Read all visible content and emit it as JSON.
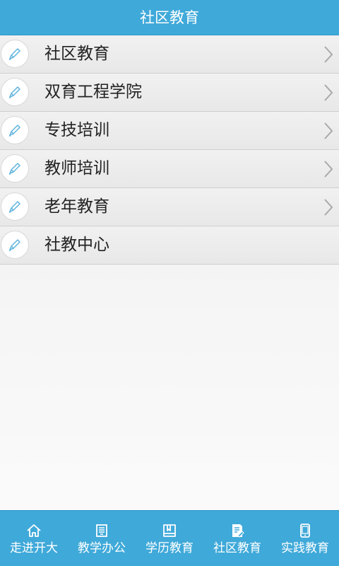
{
  "header": {
    "title": "社区教育"
  },
  "list": {
    "items": [
      {
        "label": "社区教育",
        "has_arrow": true
      },
      {
        "label": "双育工程学院",
        "has_arrow": true
      },
      {
        "label": "专技培训",
        "has_arrow": true
      },
      {
        "label": "教师培训",
        "has_arrow": true
      },
      {
        "label": "老年教育",
        "has_arrow": true
      },
      {
        "label": "社教中心",
        "has_arrow": false
      }
    ],
    "icon": "pencil-icon"
  },
  "tabbar": {
    "items": [
      {
        "label": "走进开大",
        "icon": "home-icon"
      },
      {
        "label": "教学办公",
        "icon": "monitor-icon"
      },
      {
        "label": "学历教育",
        "icon": "book-icon"
      },
      {
        "label": "社区教育",
        "icon": "document-edit-icon"
      },
      {
        "label": "实践教育",
        "icon": "phone-icon"
      }
    ]
  },
  "colors": {
    "accent": "#3fa9d9",
    "pencil": "#5fb3dc"
  }
}
